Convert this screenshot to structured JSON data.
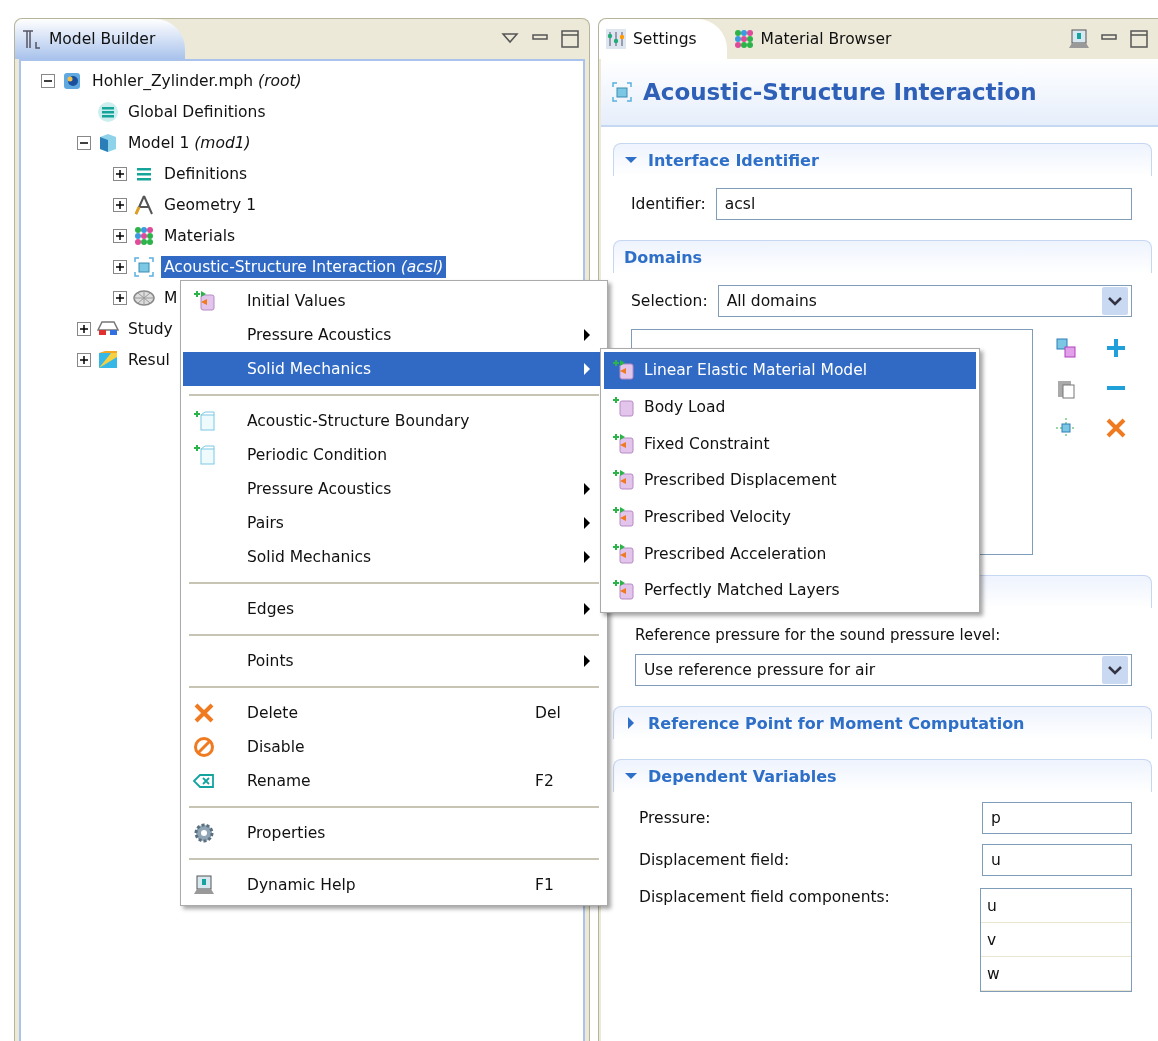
{
  "model_builder": {
    "title": "Model Builder",
    "tree": [
      {
        "label": "Hohler_Zylinder.mph *(root)*",
        "kind": "file",
        "expanded": true,
        "selected": false,
        "children": [
          {
            "label": "Global Definitions",
            "kind": "global",
            "selected": false
          },
          {
            "label": "Model 1 *(mod1)*",
            "kind": "model",
            "expanded": true,
            "selected": false,
            "children": [
              {
                "label": "Definitions",
                "kind": "definitions",
                "expanded": false,
                "selected": false
              },
              {
                "label": "Geometry 1",
                "kind": "geometry",
                "expanded": false,
                "selected": false
              },
              {
                "label": "Materials",
                "kind": "materials",
                "expanded": false,
                "selected": false
              },
              {
                "label": "Acoustic-Structure Interaction *(acsl)*",
                "kind": "physics",
                "expanded": false,
                "selected": true
              },
              {
                "label": "M",
                "kind": "mesh",
                "expanded": false,
                "selected": false
              }
            ]
          },
          {
            "label": "Study",
            "kind": "study",
            "expanded": false,
            "selected": false
          },
          {
            "label": "Resul",
            "kind": "results",
            "expanded": false,
            "selected": false
          }
        ]
      }
    ]
  },
  "context_menu": {
    "groups": [
      [
        {
          "label": "Initial Values",
          "kind": "domain-feature",
          "submenu": false,
          "selected": false
        },
        {
          "label": "Pressure Acoustics",
          "kind": "none",
          "submenu": true,
          "selected": false
        },
        {
          "label": "Solid Mechanics",
          "kind": "none",
          "submenu": true,
          "selected": true
        }
      ],
      [
        {
          "label": "Acoustic-Structure Boundary",
          "kind": "boundary-feature",
          "submenu": false,
          "selected": false
        },
        {
          "label": "Periodic Condition",
          "kind": "boundary-feature",
          "submenu": false,
          "selected": false
        },
        {
          "label": "Pressure Acoustics",
          "kind": "none",
          "submenu": true,
          "selected": false
        },
        {
          "label": "Pairs",
          "kind": "none",
          "submenu": true,
          "selected": false
        },
        {
          "label": "Solid Mechanics",
          "kind": "none",
          "submenu": true,
          "selected": false
        }
      ],
      [
        {
          "label": "Edges",
          "kind": "none",
          "submenu": true,
          "selected": false
        }
      ],
      [
        {
          "label": "Points",
          "kind": "none",
          "submenu": true,
          "selected": false
        }
      ],
      [
        {
          "label": "Delete",
          "kind": "delete",
          "shortcut": "Del",
          "submenu": false,
          "selected": false
        },
        {
          "label": "Disable",
          "kind": "disable",
          "submenu": false,
          "selected": false
        },
        {
          "label": "Rename",
          "kind": "rename",
          "shortcut": "F2",
          "submenu": false,
          "selected": false
        }
      ],
      [
        {
          "label": "Properties",
          "kind": "properties",
          "submenu": false,
          "selected": false
        }
      ],
      [
        {
          "label": "Dynamic Help",
          "kind": "help",
          "shortcut": "F1",
          "submenu": false,
          "selected": false
        }
      ]
    ]
  },
  "submenu": {
    "items": [
      {
        "label": "Linear Elastic Material Model",
        "kind": "domain-feature",
        "selected": true
      },
      {
        "label": "Body Load",
        "kind": "body-feature",
        "selected": false
      },
      {
        "label": "Fixed Constraint",
        "kind": "domain-feature",
        "selected": false
      },
      {
        "label": "Prescribed Displacement",
        "kind": "domain-feature",
        "selected": false
      },
      {
        "label": "Prescribed Velocity",
        "kind": "domain-feature",
        "selected": false
      },
      {
        "label": "Prescribed Acceleration",
        "kind": "domain-feature",
        "selected": false
      },
      {
        "label": "Perfectly Matched Layers",
        "kind": "domain-feature",
        "selected": false
      }
    ]
  },
  "settings": {
    "tabs": [
      {
        "label": "Settings",
        "kind": "settings",
        "selected": true
      },
      {
        "label": "Material Browser",
        "kind": "materials",
        "selected": false
      }
    ],
    "title": "Acoustic-Structure Interaction",
    "sections": [
      {
        "title": "Interface Identifier",
        "expanded": true,
        "rows": [
          {
            "kind": "inline-field",
            "label": "Identifier:",
            "value": "acsl"
          }
        ]
      },
      {
        "title": "Domains",
        "rows": [
          {
            "kind": "inline-dropdown",
            "label": "Selection:",
            "value": "All domains"
          },
          {
            "kind": "selection-list"
          }
        ]
      },
      {
        "rows": [
          {
            "kind": "label-dropdown",
            "label": "Reference pressure for the sound pressure level:",
            "value": "Use reference pressure for air"
          }
        ]
      },
      {
        "title": "Reference Point for Moment Computation",
        "expanded": false
      },
      {
        "title": "Dependent Variables",
        "expanded": true,
        "rows": [
          {
            "kind": "var-field",
            "label": "Pressure:",
            "value": "p"
          },
          {
            "kind": "var-field",
            "label": "Displacement field:",
            "value": "u"
          },
          {
            "kind": "var-list",
            "label": "Displacement field components:",
            "values": [
              "u",
              "v",
              "w"
            ]
          }
        ]
      }
    ]
  }
}
